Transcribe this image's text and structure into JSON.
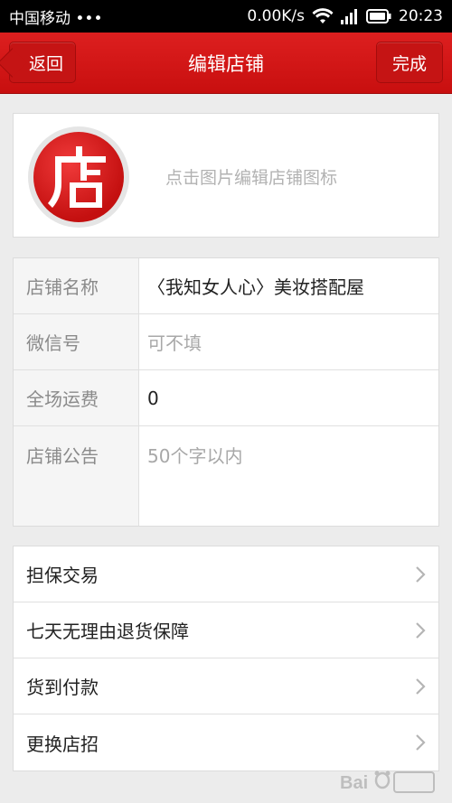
{
  "status_bar": {
    "carrier": "中国移动 •••",
    "speed": "0.00K/s",
    "time": "20:23"
  },
  "nav": {
    "back_label": "返回",
    "title": "编辑店铺",
    "done_label": "完成"
  },
  "logo": {
    "glyph": "店",
    "hint": "点击图片编辑店铺图标"
  },
  "form": {
    "rows": [
      {
        "label": "店铺名称",
        "value": "〈我知女人心〉美妆搭配屋"
      },
      {
        "label": "微信号",
        "placeholder": "可不填"
      },
      {
        "label": "全场运费",
        "value": "0"
      },
      {
        "label": "店铺公告",
        "placeholder": "50个字以内"
      }
    ]
  },
  "options": [
    {
      "label": "担保交易"
    },
    {
      "label": "七天无理由退货保障"
    },
    {
      "label": "货到付款"
    },
    {
      "label": "更换店招"
    }
  ],
  "colors": {
    "brand_red": "#d41616",
    "page_bg": "#ececec"
  },
  "icons": [
    "wifi-icon",
    "signal-icon",
    "battery-icon",
    "chevron-right-icon",
    "shop-logo"
  ]
}
